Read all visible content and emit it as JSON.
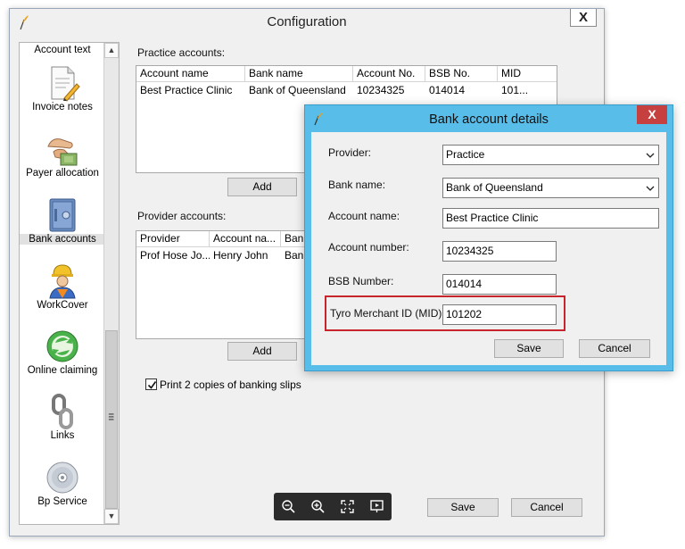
{
  "main_window": {
    "title": "Configuration",
    "close_label": "X",
    "sidebar": {
      "items": [
        {
          "label": "Account text",
          "icon": "account-text-icon"
        },
        {
          "label": "Invoice notes",
          "icon": "invoice-notes-icon"
        },
        {
          "label": "Payer allocation",
          "icon": "payer-allocation-icon"
        },
        {
          "label": "Bank accounts",
          "icon": "bank-safe-icon",
          "selected": true
        },
        {
          "label": "WorkCover",
          "icon": "workcover-worker-icon"
        },
        {
          "label": "Online claiming",
          "icon": "online-claiming-icon"
        },
        {
          "label": "Links",
          "icon": "links-chain-icon"
        },
        {
          "label": "Bp Service",
          "icon": "bp-service-disc-icon"
        }
      ]
    },
    "practice_accounts": {
      "label": "Practice accounts:",
      "columns": [
        "Account name",
        "Bank name",
        "Account No.",
        "BSB No.",
        "MID"
      ],
      "rows": [
        [
          "Best Practice Clinic",
          "Bank of Queensland",
          "10234325",
          "014014",
          "101..."
        ]
      ],
      "add_label": "Add"
    },
    "provider_accounts": {
      "label": "Provider accounts:",
      "columns": [
        "Provider",
        "Account na...",
        "Ban"
      ],
      "rows": [
        [
          "Prof Hose Jo...",
          "Henry John",
          "Ban"
        ]
      ],
      "add_label": "Add"
    },
    "print_copies": {
      "label": "Print 2 copies of banking slips",
      "checked": true
    },
    "save_label": "Save",
    "cancel_label": "Cancel"
  },
  "zoom_toolbar": {
    "icons": [
      "zoom-out-icon",
      "zoom-in-icon",
      "fit-screen-icon",
      "presentation-icon"
    ]
  },
  "dialog": {
    "title": "Bank account details",
    "close_label": "X",
    "provider": {
      "label": "Provider:",
      "value": "Practice"
    },
    "bank_name": {
      "label": "Bank name:",
      "value": "Bank of Queensland"
    },
    "account_name": {
      "label": "Account name:",
      "value": "Best Practice Clinic"
    },
    "account_number": {
      "label": "Account number:",
      "value": "10234325"
    },
    "bsb_number": {
      "label": "BSB Number:",
      "value": "014014"
    },
    "tyro_mid": {
      "label": "Tyro Merchant ID (MID):",
      "value": "101202"
    },
    "save_label": "Save",
    "cancel_label": "Cancel",
    "highlight_color": "#c8242b",
    "frame_color": "#59bde9",
    "close_color": "#c74040"
  }
}
